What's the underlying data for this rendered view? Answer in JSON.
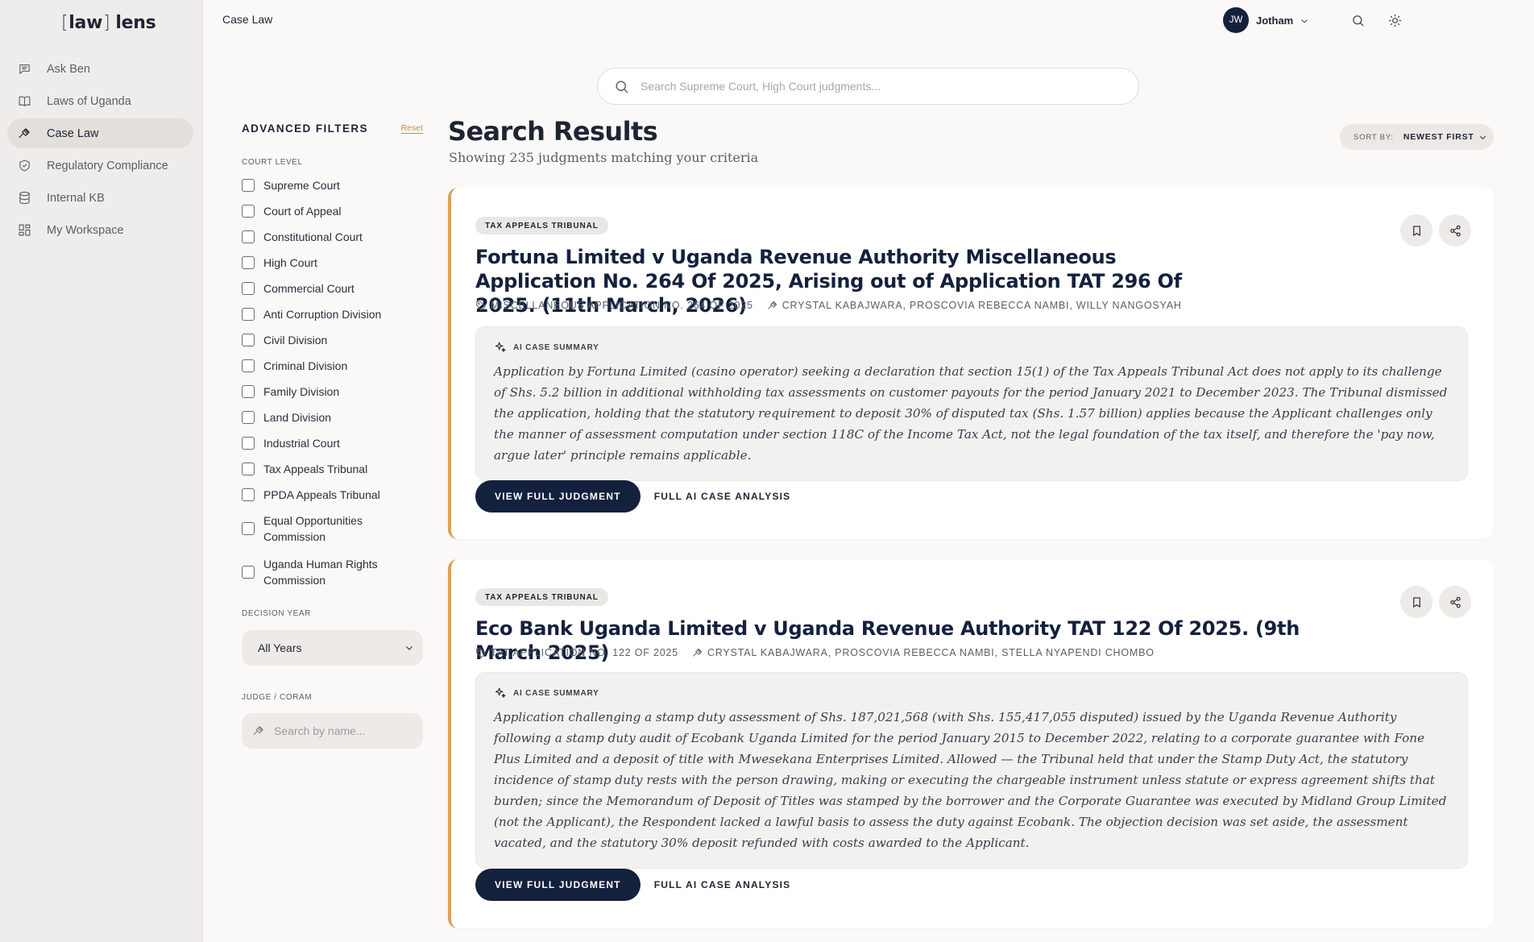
{
  "brand": {
    "logo_word1": "law",
    "logo_word2": "lens"
  },
  "sidebar": {
    "items": [
      {
        "label": "Ask Ben",
        "icon": "chat-icon"
      },
      {
        "label": "Laws of Uganda",
        "icon": "book-icon"
      },
      {
        "label": "Case Law",
        "icon": "gavel-icon",
        "active": true
      },
      {
        "label": "Regulatory Compliance",
        "icon": "shield-icon"
      },
      {
        "label": "Internal KB",
        "icon": "database-icon"
      },
      {
        "label": "My Workspace",
        "icon": "grid-icon"
      }
    ]
  },
  "header": {
    "breadcrumb": "Case Law",
    "user": {
      "initials": "JW",
      "name": "Jotham"
    }
  },
  "search": {
    "placeholder": "Search Supreme Court, High Court judgments..."
  },
  "filters": {
    "title": "ADVANCED FILTERS",
    "reset_label": "Reset",
    "court_level_label": "COURT LEVEL",
    "courts": [
      "Supreme Court",
      "Court of Appeal",
      "Constitutional Court",
      "High Court",
      "Commercial Court",
      "Anti Corruption Division",
      "Civil Division",
      "Criminal Division",
      "Family Division",
      "Land Division",
      "Industrial Court",
      "Tax Appeals Tribunal",
      "PPDA Appeals Tribunal",
      "Equal Opportunities Commission",
      "Uganda Human Rights Commission"
    ],
    "decision_year_label": "DECISION YEAR",
    "decision_year_value": "All Years",
    "judge_label": "JUDGE / CORAM",
    "judge_placeholder": "Search by name..."
  },
  "results": {
    "title": "Search Results",
    "subtitle": "Showing 235 judgments matching your criteria",
    "sort_label": "SORT BY:",
    "sort_value": "NEWEST FIRST",
    "cards": [
      {
        "court": "TAX APPEALS TRIBUNAL",
        "title": "Fortuna Limited v Uganda Revenue Authority Miscellaneous Application No. 264 Of 2025, Arising out of Application TAT 296 Of 2025. (11th March, 2026)",
        "case_no": "MISCELLANEOUS APPLICATION NO. 264 OF 2025",
        "judges": "CRYSTAL KABAJWARA, PROSCOVIA REBECCA NAMBI, WILLY NANGOSYAH",
        "summary_label": "AI CASE SUMMARY",
        "summary": "Application by Fortuna Limited (casino operator) seeking a declaration that section 15(1) of the Tax Appeals Tribunal Act does not apply to its challenge of Shs. 5.2 billion in additional withholding tax assessments on customer payouts for the period January 2021 to December 2023. The Tribunal dismissed the application, holding that the statutory requirement to deposit 30% of disputed tax (Shs. 1.57 billion) applies because the Applicant challenges only the manner of assessment computation under section 118C of the Income Tax Act, not the legal foundation of the tax itself, and therefore the 'pay now, argue later' principle remains applicable.",
        "view_label": "VIEW FULL JUDGMENT",
        "analysis_label": "FULL AI CASE ANALYSIS"
      },
      {
        "court": "TAX APPEALS TRIBUNAL",
        "title": "Eco Bank Uganda Limited v Uganda Revenue Authority TAT 122 Of 2025. (9th March 2025)",
        "case_no": "TAT APPLICATION NO. 122 OF 2025",
        "judges": "CRYSTAL KABAJWARA, PROSCOVIA REBECCA NAMBI, STELLA NYAPENDI CHOMBO",
        "summary_label": "AI CASE SUMMARY",
        "summary": "Application challenging a stamp duty assessment of Shs. 187,021,568 (with Shs. 155,417,055 disputed) issued by the Uganda Revenue Authority following a stamp duty audit of Ecobank Uganda Limited for the period January 2015 to December 2022, relating to a corporate guarantee with Fone Plus Limited and a deposit of title with Mwesekana Enterprises Limited. Allowed — the Tribunal held that under the Stamp Duty Act, the statutory incidence of stamp duty rests with the person drawing, making or executing the chargeable instrument unless statute or express agreement shifts that burden; since the Memorandum of Deposit of Titles was stamped by the borrower and the Corporate Guarantee was executed by Midland Group Limited (not the Applicant), the Respondent lacked a lawful basis to assess the duty against Ecobank. The objection decision was set aside, the assessment vacated, and the statutory 30% deposit refunded with costs awarded to the Applicant.",
        "view_label": "VIEW FULL JUDGMENT",
        "analysis_label": "FULL AI CASE ANALYSIS"
      }
    ]
  }
}
